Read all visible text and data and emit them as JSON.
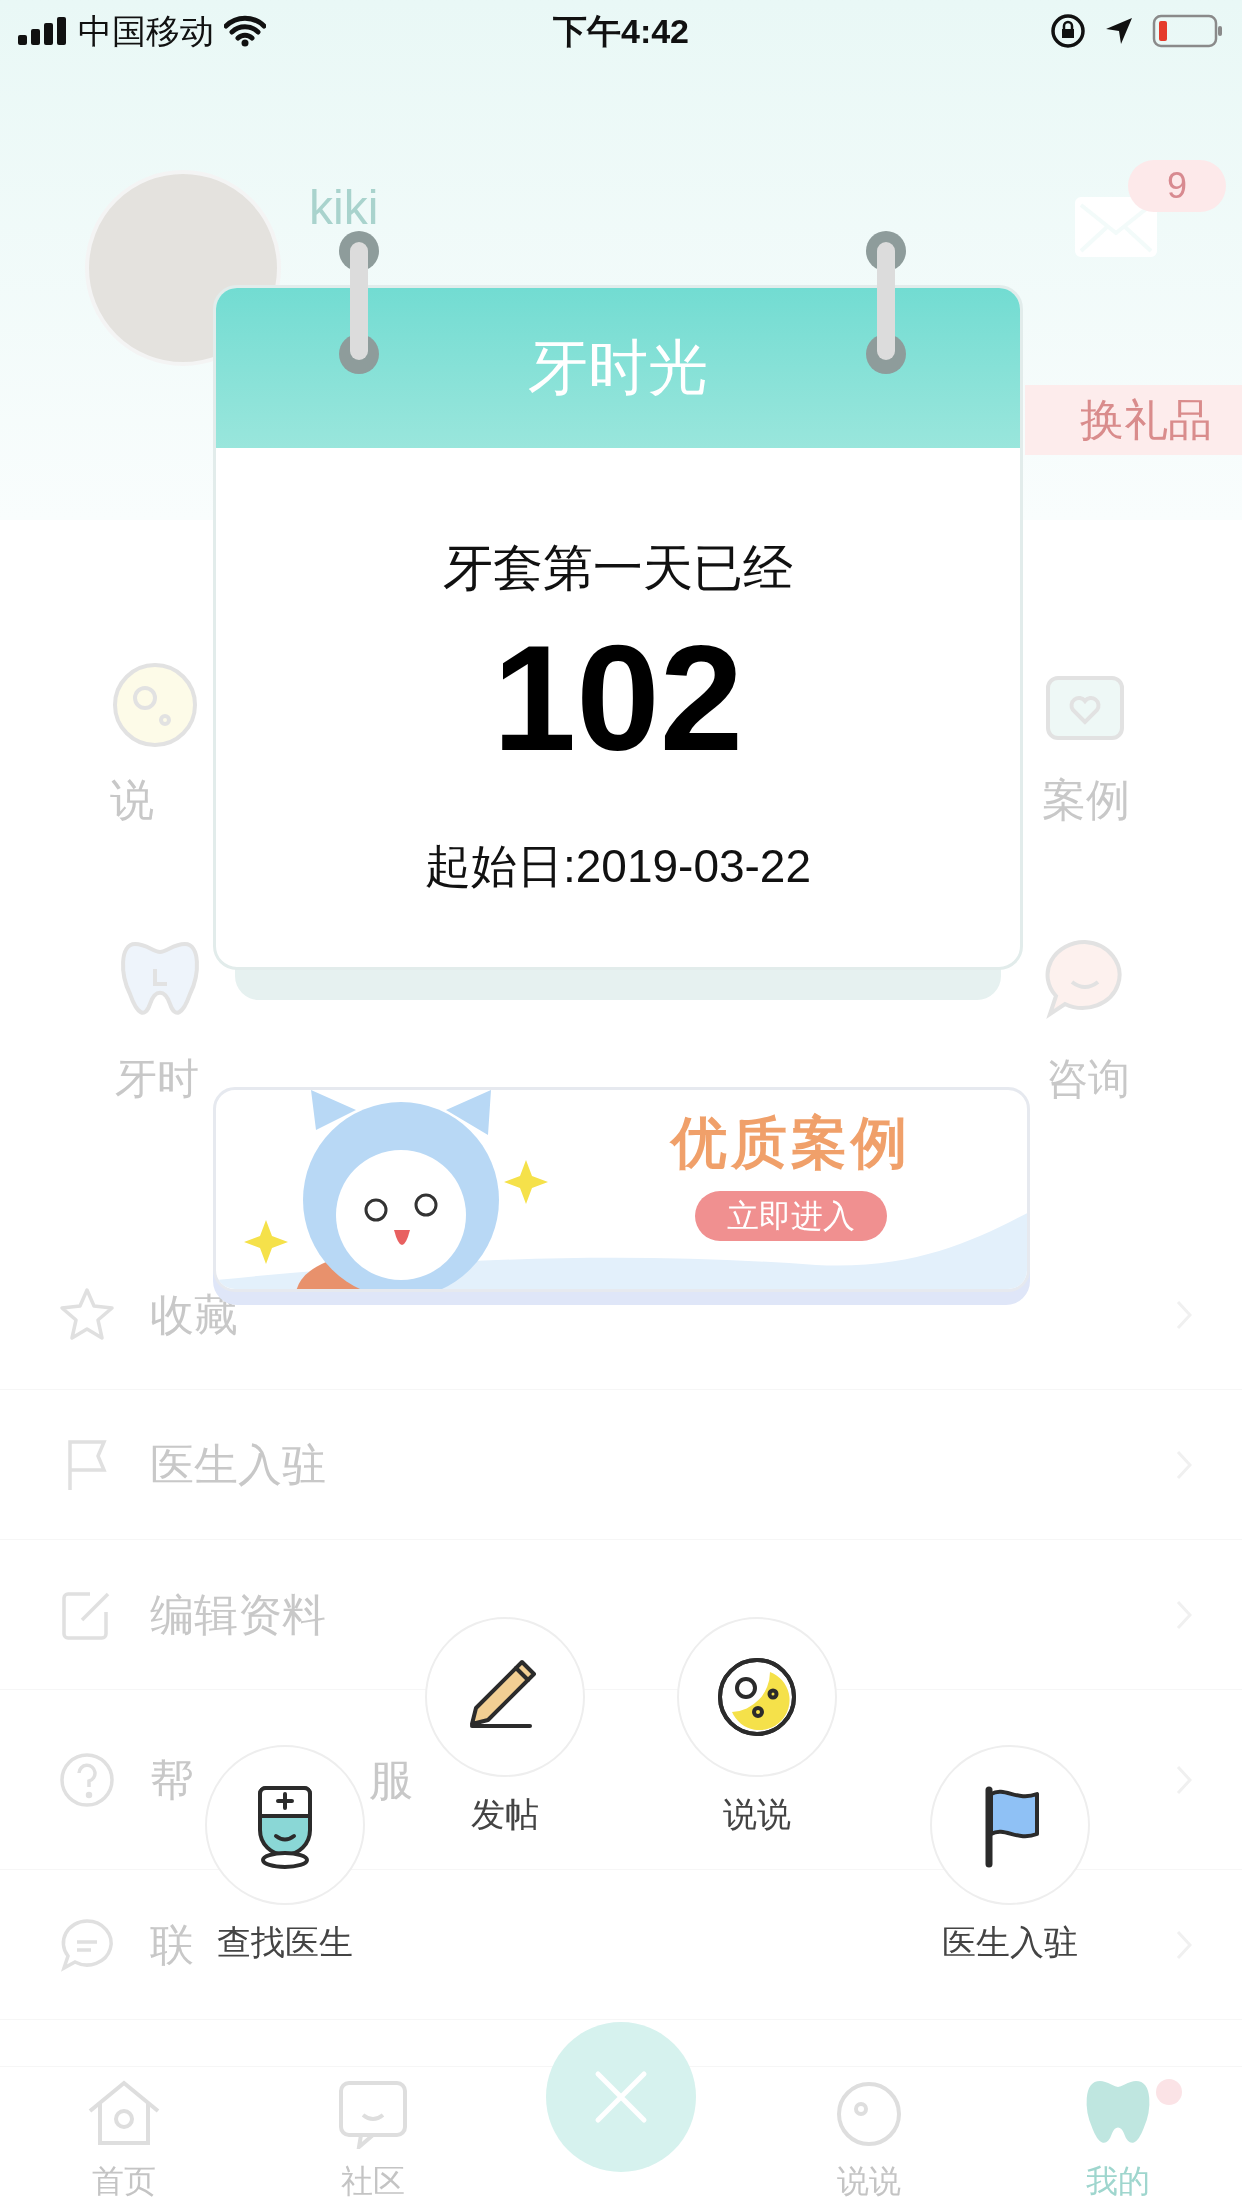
{
  "status_bar": {
    "carrier": "中国移动",
    "time": "下午4:42"
  },
  "profile": {
    "name": "kiki",
    "message_count": "9",
    "gift_button": "换礼品"
  },
  "shortcuts": [
    {
      "kind": "moments",
      "label": "说"
    },
    {
      "kind": "case",
      "label": "案例"
    },
    {
      "kind": "tooth",
      "label": "牙时"
    },
    {
      "kind": "consult",
      "label": "咨询"
    }
  ],
  "menu": [
    {
      "kind": "star",
      "label": "收藏"
    },
    {
      "kind": "flag",
      "label": "医生入驻"
    },
    {
      "kind": "edit",
      "label": "编辑资料"
    },
    {
      "kind": "help",
      "label": "帮",
      "label_end": "服"
    },
    {
      "kind": "contact",
      "label": "联"
    }
  ],
  "tabs": [
    {
      "kind": "home",
      "label": "首页",
      "selected": false,
      "dot": false
    },
    {
      "kind": "community",
      "label": "社区",
      "selected": false,
      "dot": false
    },
    {
      "kind": "moments",
      "label": "说说",
      "selected": false,
      "dot": false
    },
    {
      "kind": "mine",
      "label": "我的",
      "selected": true,
      "dot": true
    }
  ],
  "calendar": {
    "title": "牙时光",
    "caption": "牙套第一天已经",
    "days": "102",
    "start_date": "起始日:2019-03-22"
  },
  "banner": {
    "title": "优质案例",
    "button": "立即进入"
  },
  "actions": [
    {
      "kind": "post",
      "label": "发帖"
    },
    {
      "kind": "moments",
      "label": "说说"
    },
    {
      "kind": "doctor",
      "label": "查找医生"
    },
    {
      "kind": "join",
      "label": "医生入驻"
    }
  ]
}
